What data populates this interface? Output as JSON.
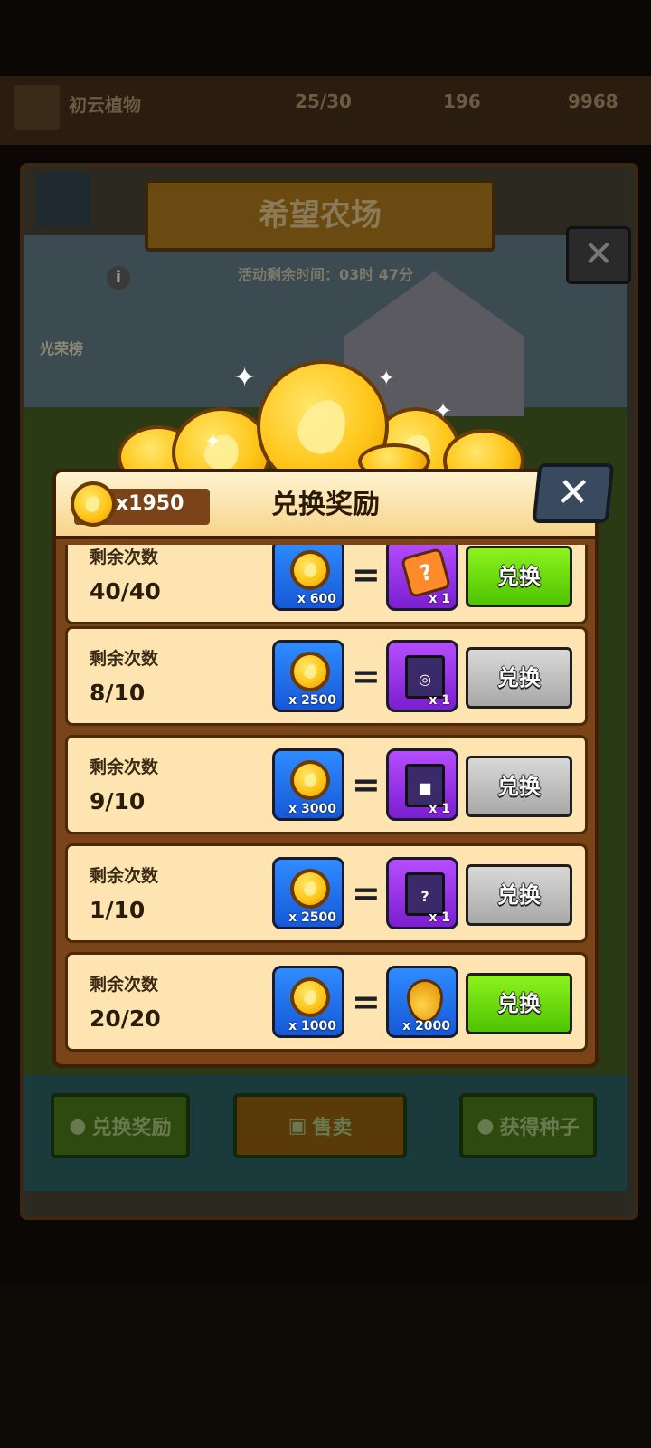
{
  "background": {
    "title": "希望农场",
    "timer": "活动剩余时间：03时 47分",
    "rank_label": "光荣榜",
    "top_player": "初云植物",
    "top_energy": "25/30",
    "top_val1": "196",
    "top_val2": "9968",
    "bottom_buttons": [
      "兑换奖励",
      "售卖",
      "获得种子"
    ]
  },
  "modal": {
    "title": "兑换奖励",
    "balance": "x1950",
    "close_label": "✕",
    "rows": [
      {
        "label": "剩余次数",
        "count": "40/40",
        "cost": "x 600",
        "reward_qty": "x 1",
        "reward": "puzzle-icon",
        "button": "兑换",
        "enabled": true
      },
      {
        "label": "剩余次数",
        "count": "8/10",
        "cost": "x 2500",
        "reward_qty": "x 1",
        "reward": "chest-icon",
        "button": "兑换",
        "enabled": false
      },
      {
        "label": "剩余次数",
        "count": "9/10",
        "cost": "x 3000",
        "reward_qty": "x 1",
        "reward": "chest-icon",
        "button": "兑换",
        "enabled": false
      },
      {
        "label": "剩余次数",
        "count": "1/10",
        "cost": "x 2500",
        "reward_qty": "x 1",
        "reward": "mystery-chest-icon",
        "button": "兑换",
        "enabled": false
      },
      {
        "label": "剩余次数",
        "count": "20/20",
        "cost": "x 1000",
        "reward_qty": "x 2000",
        "reward": "drop-icon",
        "button": "兑换",
        "enabled": true
      }
    ]
  },
  "colors": {
    "enabled": "#5fd000",
    "disabled": "#b0b0b0",
    "panel": "#fde4b0",
    "frame": "#7a4418"
  }
}
